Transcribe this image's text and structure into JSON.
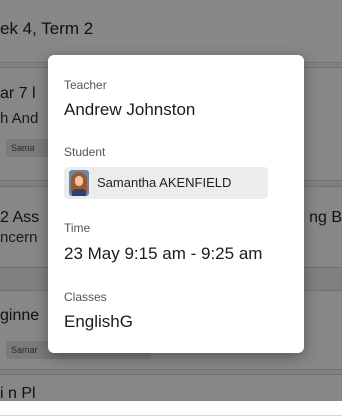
{
  "background": {
    "header_title": "ek 4, Term 2",
    "cards": [
      {
        "line1": "ar 7 l",
        "line2": "h And",
        "chip": "Sama"
      },
      {
        "line1": "2 Ass",
        "line2": "ncern",
        "right": "ng B"
      },
      {
        "line1": "ginne",
        "chip": "Samar"
      },
      {
        "line1": "i  n  Pl"
      }
    ]
  },
  "popup": {
    "teacher_label": "Teacher",
    "teacher_value": "Andrew Johnston",
    "student_label": "Student",
    "student_name": "Samantha AKENFIELD",
    "time_label": "Time",
    "time_value": "23 May 9:15 am - 9:25 am",
    "classes_label": "Classes",
    "classes_value": "EnglishG"
  },
  "colors": {
    "overlay": "#000000",
    "popup_bg": "#ffffff",
    "chip_bg": "#ececec"
  }
}
